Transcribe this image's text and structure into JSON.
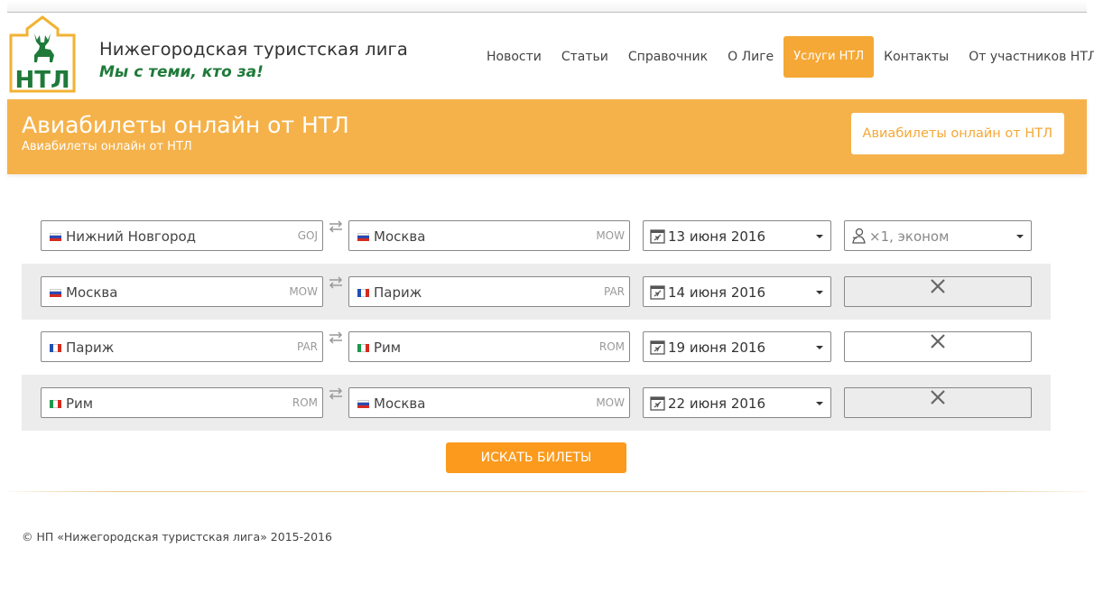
{
  "header": {
    "site_title": "Нижегородская туристская лига",
    "slogan": "Мы с теми, кто за!",
    "logo_text": "НТЛ"
  },
  "nav": {
    "items": [
      {
        "label": "Новости"
      },
      {
        "label": "Статьи"
      },
      {
        "label": "Справочник"
      },
      {
        "label": "О Лиге"
      },
      {
        "label": "Услуги НТЛ",
        "active": true
      },
      {
        "label": "Контакты"
      },
      {
        "label": "От участников НТЛ"
      }
    ]
  },
  "banner": {
    "title": "Авиабилеты онлайн от НТЛ",
    "subtitle": "Авиабилеты онлайн от НТЛ",
    "button_label": "Авиабилеты онлайн от НТЛ"
  },
  "routes": [
    {
      "from": {
        "city": "Нижний Новгород",
        "code": "GOJ",
        "flag": "ru"
      },
      "to": {
        "city": "Москва",
        "code": "MOW",
        "flag": "ru"
      },
      "date": "13 июня 2016"
    },
    {
      "from": {
        "city": "Москва",
        "code": "MOW",
        "flag": "ru"
      },
      "to": {
        "city": "Париж",
        "code": "PAR",
        "flag": "fr"
      },
      "date": "14 июня 2016"
    },
    {
      "from": {
        "city": "Париж",
        "code": "PAR",
        "flag": "fr"
      },
      "to": {
        "city": "Рим",
        "code": "ROM",
        "flag": "it"
      },
      "date": "19 июня 2016"
    },
    {
      "from": {
        "city": "Рим",
        "code": "ROM",
        "flag": "it"
      },
      "to": {
        "city": "Москва",
        "code": "MOW",
        "flag": "ru"
      },
      "date": "22 июня 2016"
    }
  ],
  "passengers": {
    "label": "×1, эконом"
  },
  "search": {
    "button_label": "ИСКАТЬ БИЛЕТЫ"
  },
  "footer": {
    "copyright": "© НП «Нижегородская туристская лига» 2015-2016"
  },
  "colors": {
    "accent": "#f5b24a",
    "button": "#fb9a1d",
    "brand_green": "#1f7a3a"
  },
  "icons": {
    "logo": "elk-logo-icon",
    "swap": "swap-arrows-icon",
    "calendar": "calendar-plane-icon",
    "passenger": "passenger-icon",
    "remove": "close-icon"
  }
}
